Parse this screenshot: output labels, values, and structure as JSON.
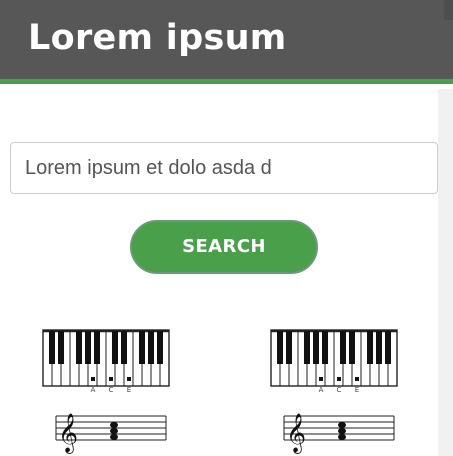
{
  "header": {
    "title": "Lorem ipsum"
  },
  "search": {
    "value": "Lorem ipsum et dolo asda d",
    "button_label": "SEARCH"
  },
  "chords": [
    {
      "notes": [
        "A",
        "C",
        "E"
      ]
    },
    {
      "notes": [
        "A",
        "C",
        "E"
      ]
    }
  ],
  "colors": {
    "header_bg": "#575757",
    "accent": "#4aa04a",
    "text_light": "#ffffff"
  },
  "icons": {
    "staff": "treble-clef-icon",
    "keyboard": "piano-keyboard-icon"
  }
}
